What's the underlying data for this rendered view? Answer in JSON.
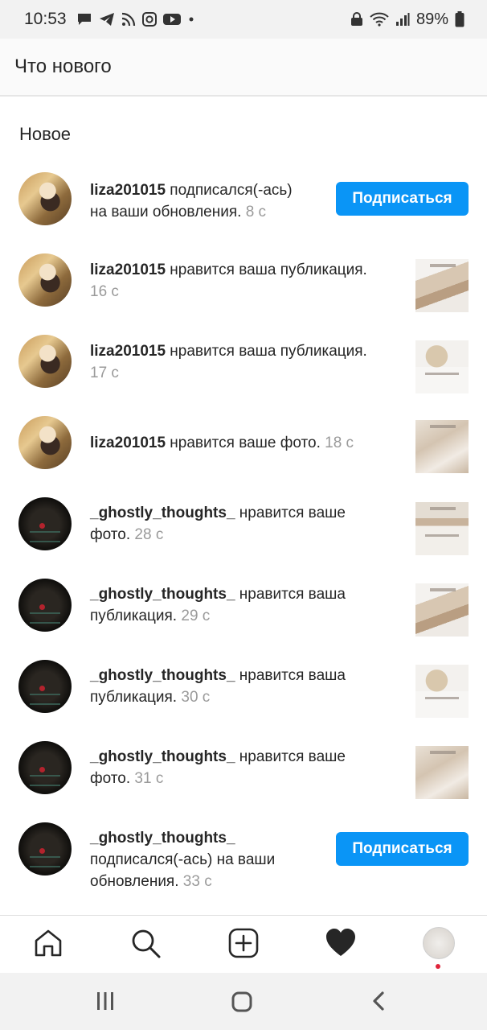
{
  "status_bar": {
    "time": "10:53",
    "battery": "89%",
    "icons": [
      "message-icon",
      "telegram-icon",
      "rss-icon",
      "instagram-icon",
      "youtube-icon",
      "dot-icon",
      "lock-icon",
      "wifi-icon",
      "signal-icon",
      "battery-icon"
    ]
  },
  "header": {
    "title": "Что нового"
  },
  "section_title": "Новое",
  "notifications": [
    {
      "username": "liza201015",
      "text_line1": " подписался(-ась)",
      "text_line2": "на ваши обновления. ",
      "time": "8 с",
      "action": "follow",
      "avatar": "liza"
    },
    {
      "username": "liza201015",
      "text_line1": " нравится ваша публикация.",
      "text_line2": "",
      "time": "16 с",
      "action": "thumb",
      "avatar": "liza"
    },
    {
      "username": "liza201015",
      "text_line1": " нравится ваша публикация.",
      "text_line2": "",
      "time": "17 с",
      "action": "thumb",
      "avatar": "liza"
    },
    {
      "username": "liza201015",
      "text_line1": " нравится ваше фото. ",
      "text_line2": "",
      "time": "18 с",
      "action": "thumb",
      "avatar": "liza"
    },
    {
      "username": "_ghostly_thoughts_",
      "text_line1": " нравится ваше",
      "text_line2": "фото. ",
      "time": "28 с",
      "action": "thumb",
      "avatar": "ghost"
    },
    {
      "username": "_ghostly_thoughts_",
      "text_line1": " нравится ваша",
      "text_line2": "публикация. ",
      "time": "29 с",
      "action": "thumb",
      "avatar": "ghost"
    },
    {
      "username": "_ghostly_thoughts_",
      "text_line1": " нравится ваша",
      "text_line2": "публикация. ",
      "time": "30 с",
      "action": "thumb",
      "avatar": "ghost"
    },
    {
      "username": "_ghostly_thoughts_",
      "text_line1": " нравится ваше",
      "text_line2": "фото. ",
      "time": "31 с",
      "action": "thumb",
      "avatar": "ghost"
    },
    {
      "username": "_ghostly_thoughts_",
      "text_line1": "",
      "text_line2": "подписался(-ась) на ваши",
      "text_line3": "обновления. ",
      "time": "33 с",
      "action": "follow",
      "avatar": "ghost"
    }
  ],
  "follow_label": "Подписаться",
  "bottom_nav": [
    "home-icon",
    "search-icon",
    "add-post-icon",
    "heart-icon",
    "profile-avatar"
  ],
  "system_nav": [
    "recents-icon",
    "home-button-icon",
    "back-icon"
  ],
  "colors": {
    "accent": "#0a95f6",
    "notification_dot": "#e0243a",
    "muted_text": "#9a9a9a"
  }
}
